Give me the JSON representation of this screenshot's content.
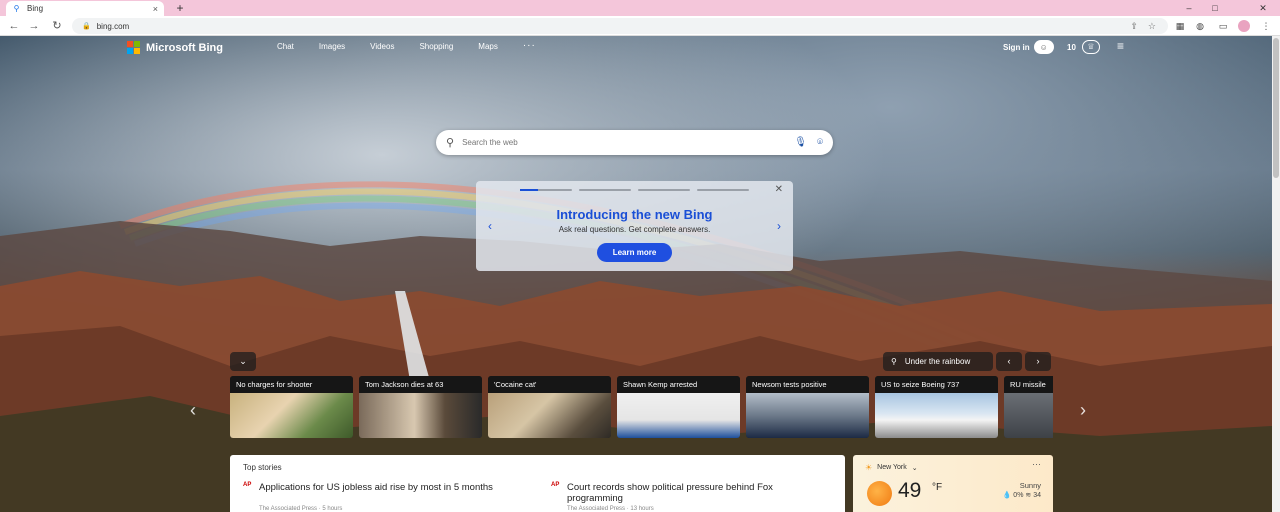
{
  "browser": {
    "tab_title": "Bing",
    "tab_favicon": "search-icon",
    "new_tab_label": "+",
    "url": "bing.com"
  },
  "bing": {
    "logo_text": "Microsoft Bing",
    "logo_colors": [
      "#f25022",
      "#7fba00",
      "#00a4ef",
      "#ffb900"
    ],
    "nav": [
      "Chat",
      "Images",
      "Videos",
      "Shopping",
      "Maps"
    ],
    "nav_more": "···",
    "signin_label": "Sign in",
    "rewards_count": "10",
    "menu_icon": "hamburger-icon"
  },
  "search": {
    "placeholder": "Search the web",
    "search_icon": "search-icon",
    "mic_icon": "microphone-icon",
    "visual_search_icon": "camera-icon"
  },
  "promo": {
    "title": "Introducing the new Bing",
    "subtitle": "Ask real questions. Get complete answers.",
    "button": "Learn more",
    "active_slide": 1,
    "slides": 4,
    "accent_color": "#1a4fd6"
  },
  "carousel": {
    "image_caption": "Under the rainbow",
    "cards": [
      {
        "title": "No charges for shooter"
      },
      {
        "title": "Tom Jackson dies at 63"
      },
      {
        "title": "'Cocaine cat'"
      },
      {
        "title": "Shawn Kemp arrested"
      },
      {
        "title": "Newsom tests positive"
      },
      {
        "title": "US to seize Boeing 737"
      },
      {
        "title": "RU missile"
      }
    ]
  },
  "top_stories": {
    "heading": "Top stories",
    "stories": [
      {
        "badge": "AP",
        "headline": "Applications for US jobless aid rise by most in 5 months",
        "source": "The Associated Press · 5 hours"
      },
      {
        "badge": "AP",
        "headline": "Court records show political pressure behind Fox programming",
        "source": "The Associated Press · 13 hours"
      }
    ]
  },
  "weather": {
    "location": "New York",
    "temperature": "49",
    "unit": "°F",
    "condition": "Sunny",
    "precip": "0%",
    "aqi": "34"
  }
}
